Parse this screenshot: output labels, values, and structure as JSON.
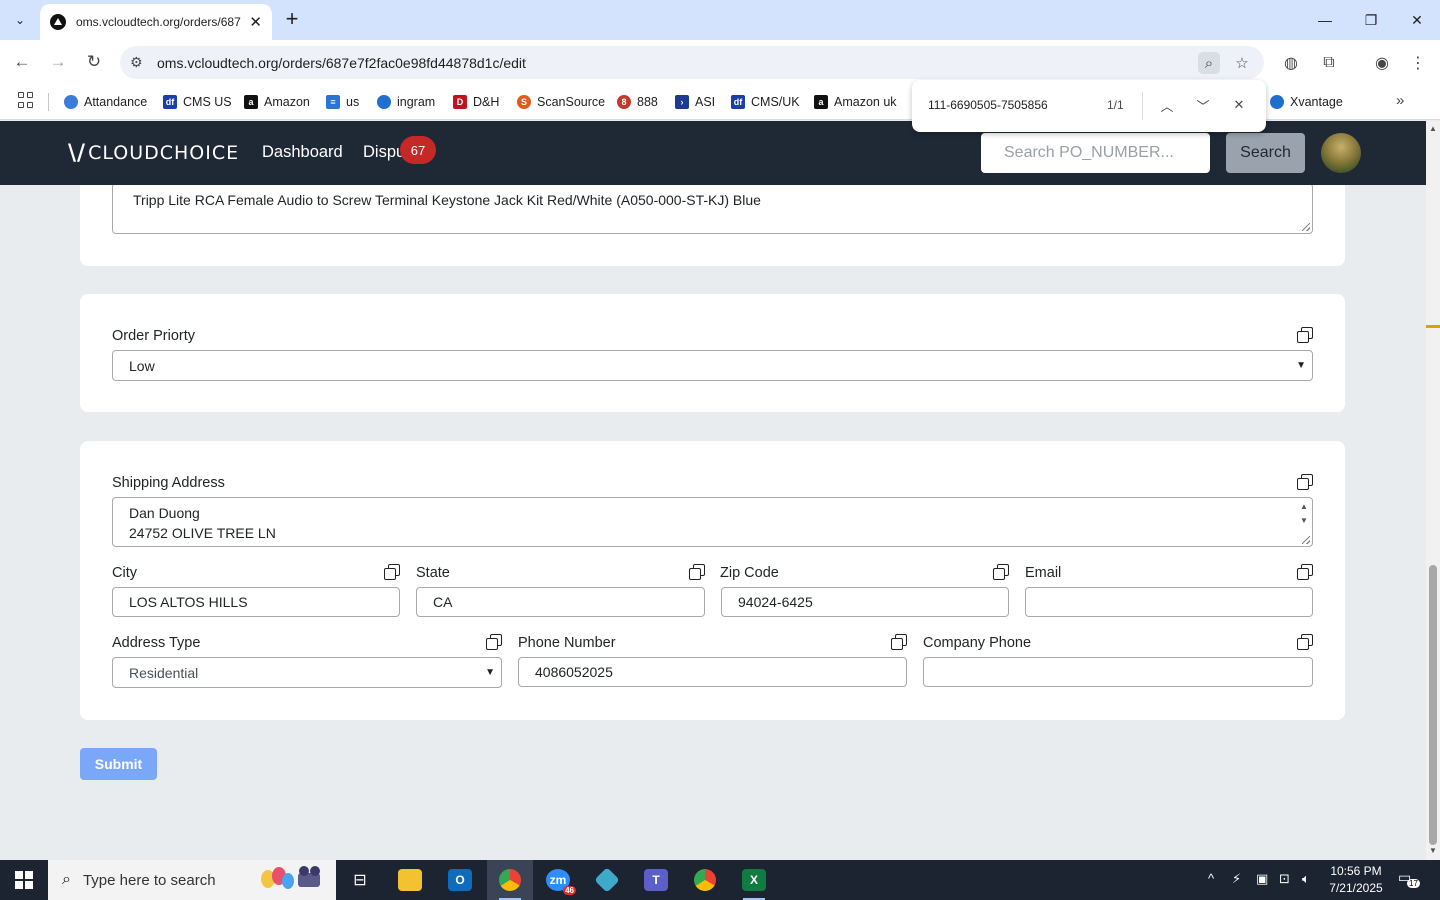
{
  "browser": {
    "tab_title": "oms.vcloudtech.org/orders/687",
    "url": "oms.vcloudtech.org/orders/687e7f2fac0e98fd44878d1c/edit",
    "bookmarks": [
      {
        "label": "Attandance",
        "color": "#3b7bd9",
        "glyph": ""
      },
      {
        "label": "CMS US",
        "color": "#1a3fa8",
        "glyph": "df"
      },
      {
        "label": "Amazon",
        "color": "#111111",
        "glyph": "a"
      },
      {
        "label": "us",
        "color": "#2a73d8",
        "glyph": "≡"
      },
      {
        "label": "ingram",
        "color": "#1f6fd1",
        "glyph": ""
      },
      {
        "label": "D&H",
        "color": "#c1121f",
        "glyph": "D"
      },
      {
        "label": "ScanSource",
        "color": "#e05a1c",
        "glyph": "S"
      },
      {
        "label": "888",
        "color": "#c0392b",
        "glyph": "8"
      },
      {
        "label": "ASI",
        "color": "#1d3c8f",
        "glyph": "›"
      },
      {
        "label": "CMS/UK",
        "color": "#1a3fa8",
        "glyph": "df"
      },
      {
        "label": "Amazon uk",
        "color": "#111111",
        "glyph": "a"
      },
      {
        "label": "Xvantage",
        "color": "#1f6fd1",
        "glyph": ""
      }
    ],
    "find": {
      "query": "111-6690505-7505856",
      "count": "1/1"
    }
  },
  "app": {
    "logo": "CLOUDCHOICE",
    "nav": {
      "dashboard": "Dashboard",
      "disputes": "Dispu",
      "disputes_badge": "67"
    },
    "search_placeholder": "Search PO_NUMBER...",
    "search_button": "Search"
  },
  "form": {
    "description_text": "Tripp Lite RCA Female Audio to Screw Terminal Keystone Jack Kit Red/White (A050-000-ST-KJ) Blue",
    "order_priority": {
      "label": "Order Priorty",
      "value": "Low"
    },
    "shipping": {
      "label": "Shipping Address",
      "line1": "Dan Duong",
      "line2": "24752 OLIVE TREE LN",
      "city_label": "City",
      "city": "LOS ALTOS HILLS",
      "state_label": "State",
      "state": "CA",
      "zip_label": "Zip Code",
      "zip": "94024-6425",
      "email_label": "Email",
      "email": "",
      "address_type_label": "Address Type",
      "address_type": "Residential",
      "phone_label": "Phone Number",
      "phone": "4086052025",
      "company_phone_label": "Company Phone",
      "company_phone": ""
    },
    "submit": "Submit"
  },
  "taskbar": {
    "search_placeholder": "Type here to search",
    "time": "10:56 PM",
    "date": "7/21/2025",
    "zoom_badge": "46",
    "notifications": "17"
  }
}
